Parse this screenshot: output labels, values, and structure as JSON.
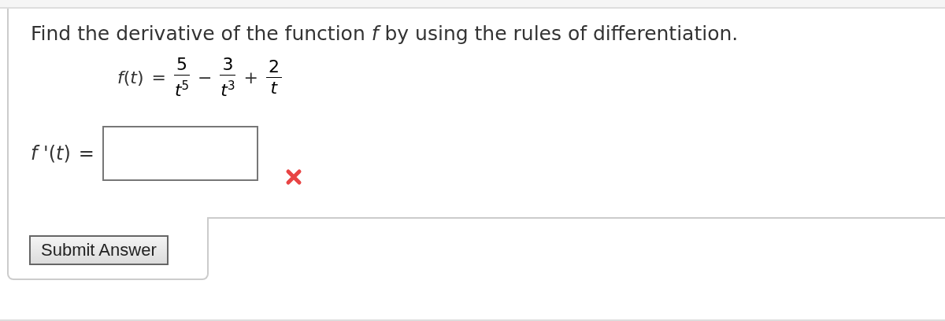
{
  "question": {
    "prompt": "Find the derivative of the function *f* by using the rules of differentiation.",
    "function": {
      "lhs": "*f*(*t*)",
      "equals": "=",
      "terms": [
        {
          "numerator": "5",
          "denominator": "*t*$^{5}$"
        },
        {
          "operator": "−",
          "numerator": "3",
          "denominator": "*t*$^{3}$"
        },
        {
          "operator": "+",
          "numerator": "2",
          "denominator": "*t*"
        }
      ]
    },
    "answer": {
      "label": "*f* '(*t*)",
      "equals": "=",
      "incorrect": true
    },
    "submit_button": "Submit Answer"
  }
}
